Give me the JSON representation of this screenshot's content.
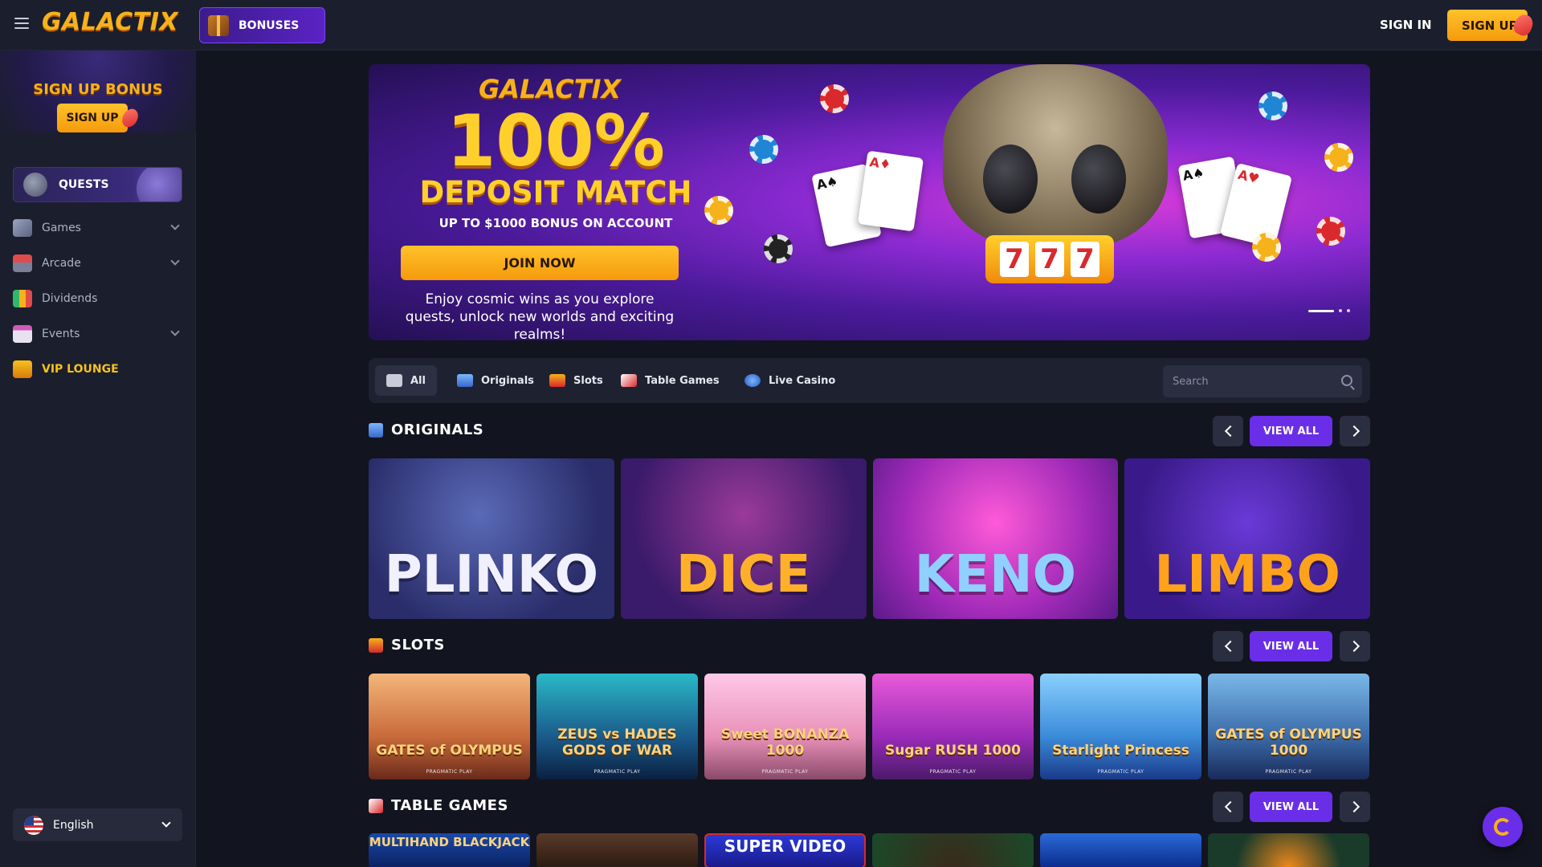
{
  "header": {
    "logo": "GALACTIX",
    "bonuses_label": "BONUSES",
    "signin_label": "SIGN IN",
    "signup_label": "SIGN UP"
  },
  "sidebar": {
    "promo_title": "SIGN UP BONUS",
    "promo_button": "SIGN UP",
    "quests_label": "QUESTS",
    "items": [
      {
        "label": "Games",
        "icon": "gamepad-icon"
      },
      {
        "label": "Arcade",
        "icon": "joystick-icon"
      },
      {
        "label": "Dividends",
        "icon": "bar-chart-icon"
      },
      {
        "label": "Events",
        "icon": "calendar-icon"
      },
      {
        "label": "VIP LOUNGE",
        "icon": "crown-icon"
      }
    ],
    "language": "English"
  },
  "hero": {
    "logo": "GALACTIX",
    "headline": "100%",
    "subheadline": "DEPOSIT MATCH",
    "offer": "UP TO $1000 BONUS ON ACCOUNT",
    "cta": "JOIN NOW",
    "description": "Enjoy cosmic wins as you explore quests, unlock new worlds and exciting realms!",
    "slot_digits": [
      "7",
      "7",
      "7"
    ],
    "cards": [
      "A♠",
      "A♦",
      "A♠",
      "A♥"
    ]
  },
  "categories": {
    "tabs": [
      {
        "label": "All",
        "icon": "gamepad-icon"
      },
      {
        "label": "Originals",
        "icon": "house-icon"
      },
      {
        "label": "Slots",
        "icon": "slot-machine-icon"
      },
      {
        "label": "Table Games",
        "icon": "cards-icon"
      },
      {
        "label": "Live Casino",
        "icon": "globe-icon"
      }
    ],
    "search_placeholder": "Search"
  },
  "sections": {
    "originals": {
      "title": "ORIGINALS",
      "view_all": "VIEW ALL",
      "games": [
        "PLINKO",
        "DICE",
        "KENO",
        "LIMBO"
      ]
    },
    "slots": {
      "title": "SLOTS",
      "view_all": "VIEW ALL",
      "games": [
        {
          "name": "GATES of OLYMPUS",
          "provider": "PRAGMATIC PLAY"
        },
        {
          "name": "ZEUS vs HADES GODS OF WAR",
          "provider": "PRAGMATIC PLAY"
        },
        {
          "name": "Sweet BONANZA 1000",
          "provider": "PRAGMATIC PLAY"
        },
        {
          "name": "Sugar RUSH 1000",
          "provider": "PRAGMATIC PLAY"
        },
        {
          "name": "Starlight Princess",
          "provider": "PRAGMATIC PLAY"
        },
        {
          "name": "GATES of OLYMPUS 1000",
          "provider": "PRAGMATIC PLAY"
        }
      ]
    },
    "table_games": {
      "title": "TABLE GAMES",
      "view_all": "VIEW ALL",
      "games": [
        "MULTIHAND BLACKJACK",
        "",
        "SUPER VIDEO",
        "",
        "",
        ""
      ]
    }
  },
  "colors": {
    "accent_purple": "#6a2ee8",
    "brand_gold": "#f6b21b",
    "background": "#12141f",
    "panel": "#1b1e2c"
  }
}
